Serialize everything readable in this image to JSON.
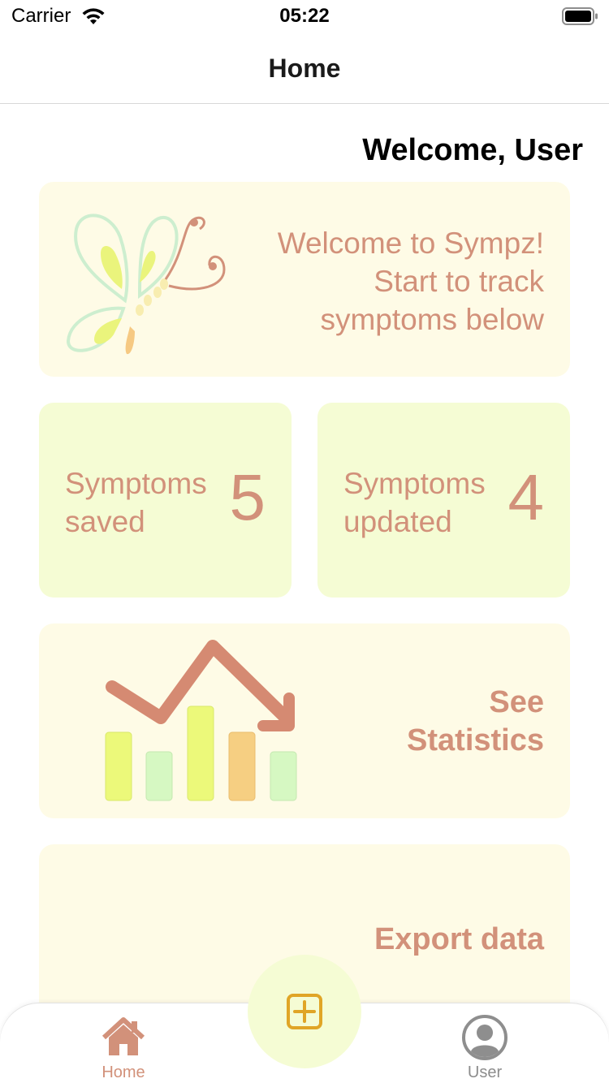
{
  "status_bar": {
    "carrier": "Carrier",
    "time": "05:22"
  },
  "nav": {
    "title": "Home"
  },
  "welcome": "Welcome, User",
  "intro_card": {
    "line1": "Welcome to Sympz!",
    "line2": "Start to track",
    "line3": "symptoms below",
    "icon": "butterfly-logo"
  },
  "saved_card": {
    "label_line1": "Symptoms",
    "label_line2": "saved",
    "value": "5"
  },
  "updated_card": {
    "label_line1": "Symptoms",
    "label_line2": "updated",
    "value": "4"
  },
  "stats_card": {
    "line1": "See",
    "line2": "Statistics",
    "icon": "chart-trend-icon"
  },
  "export_card": {
    "label": "Export data"
  },
  "tab_bar": {
    "items": [
      {
        "label": "Home",
        "icon": "home-icon",
        "selected": true
      },
      {
        "label": "User",
        "icon": "user-icon",
        "selected": false
      }
    ],
    "add_icon": "plus-square-icon"
  },
  "colors": {
    "accent": "#d2917a",
    "card_cream": "#fefbe6",
    "card_lime": "#f5fcd4",
    "add_icon": "#e0a526"
  }
}
